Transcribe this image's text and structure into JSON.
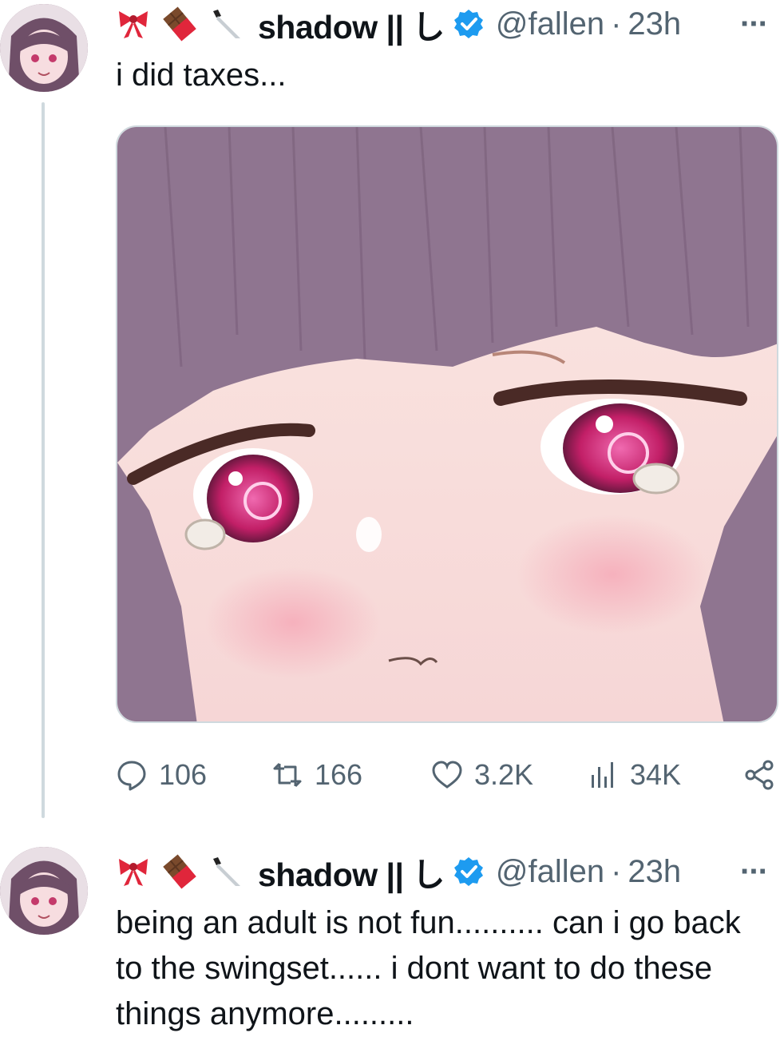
{
  "colors": {
    "text": "#0f1419",
    "secondary": "#536471",
    "verified": "#1d9bf0",
    "line": "#cfd9de"
  },
  "tweet1": {
    "emojis": [
      "ribbon-icon",
      "chocolate-icon",
      "knife-icon"
    ],
    "display_name": "shadow || し",
    "handle": "@fallen",
    "separator": "·",
    "time": "23h",
    "more": "···",
    "text": "i did taxes...",
    "actions": {
      "replies": "106",
      "reposts": "166",
      "likes": "3.2K",
      "views": "34K"
    }
  },
  "tweet2": {
    "emojis": [
      "ribbon-icon",
      "chocolate-icon",
      "knife-icon"
    ],
    "display_name": "shadow || し",
    "handle": "@fallen",
    "separator": "·",
    "time": "23h",
    "more": "···",
    "text_lines": [
      "being an adult is not fun.......... can i go back",
      "to the swingset...... i dont want to do these",
      "things anymore........."
    ]
  }
}
